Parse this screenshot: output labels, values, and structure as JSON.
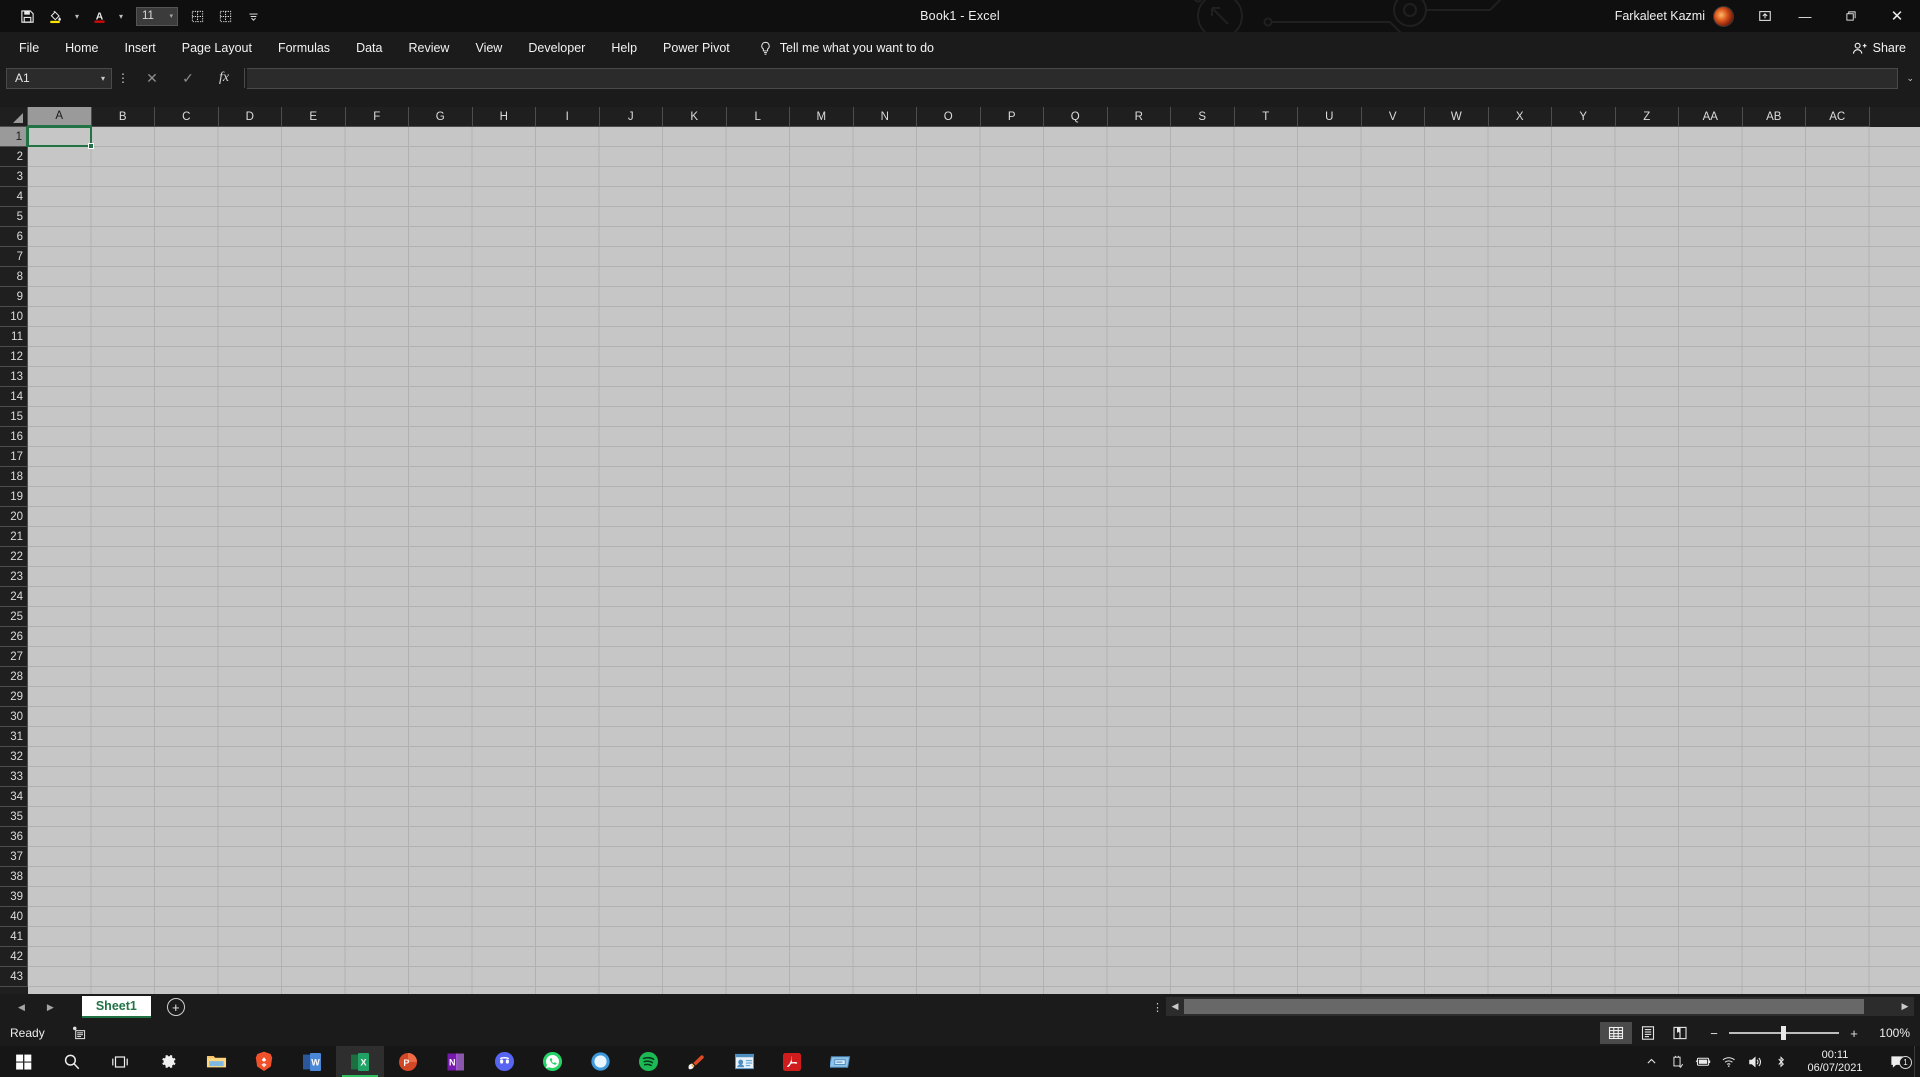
{
  "window": {
    "title": "Book1  -  Excel",
    "user_name": "Farkaleet Kazmi",
    "minimize_label": "—",
    "restore_label": "❐",
    "close_label": "✕",
    "ribbon_display_name": "ribbon-display-options"
  },
  "quick_access": {
    "items": [
      {
        "name": "save-icon",
        "label": "Save"
      },
      {
        "name": "fill-color-icon",
        "label": "Fill Color"
      },
      {
        "name": "fill-color-dropdown",
        "label": "▾"
      },
      {
        "name": "font-color-icon",
        "label": "Font Color"
      },
      {
        "name": "font-color-dropdown",
        "label": "▾"
      },
      {
        "name": "all-borders-icon",
        "label": "All Borders"
      },
      {
        "name": "outside-borders-icon",
        "label": "Outside Borders"
      },
      {
        "name": "customize-qat-icon",
        "label": "Customize Quick Access Toolbar"
      }
    ],
    "font_size": "11",
    "font_size_arrow": "▾"
  },
  "ribbon": {
    "tabs": [
      "File",
      "Home",
      "Insert",
      "Page Layout",
      "Formulas",
      "Data",
      "Review",
      "View",
      "Developer",
      "Help",
      "Power Pivot"
    ],
    "tell_me": "Tell me what you want to do",
    "share": "Share"
  },
  "formula_bar": {
    "name_box": "A1",
    "name_box_arrow": "▾",
    "kebab": "⋮",
    "cancel": "✕",
    "enter": "✓",
    "insert_function": "fx",
    "value": "",
    "expand_arrow": "⌄"
  },
  "grid": {
    "columns": [
      "A",
      "B",
      "C",
      "D",
      "E",
      "F",
      "G",
      "H",
      "I",
      "J",
      "K",
      "L",
      "M",
      "N",
      "O",
      "P",
      "Q",
      "R",
      "S",
      "T",
      "U",
      "V",
      "W",
      "X",
      "Y",
      "Z",
      "AA",
      "AB",
      "AC"
    ],
    "rows": [
      1,
      2,
      3,
      4,
      5,
      6,
      7,
      8,
      9,
      10,
      11,
      12,
      13,
      14,
      15,
      16,
      17,
      18,
      19,
      20,
      21,
      22,
      23,
      24,
      25,
      26,
      27,
      28,
      29,
      30,
      31,
      32,
      33,
      34,
      35,
      36,
      37,
      38,
      39,
      40,
      41,
      42,
      43
    ],
    "selected_cell": "A1",
    "selected_column": "A",
    "selected_row": 1,
    "selection_color": "#217346",
    "cell_background": "#c6c6c6",
    "gridline_color": "#b1b1b1"
  },
  "sheet_tabs": {
    "prev_arrow": "◀",
    "next_arrow": "▶",
    "tabs": [
      {
        "label": "Sheet1",
        "active": true
      }
    ],
    "add_label": "+",
    "kebab": "⋮"
  },
  "status_bar": {
    "status": "Ready",
    "accessibility_icon": "accessibility-checker-icon",
    "views": [
      {
        "name": "normal-view-button",
        "active": true
      },
      {
        "name": "page-layout-view-button",
        "active": false
      },
      {
        "name": "page-break-preview-button",
        "active": false
      }
    ],
    "zoom_out": "−",
    "zoom_in": "+",
    "zoom_level": "100%"
  },
  "taskbar": {
    "items": [
      {
        "name": "start-button",
        "label": "Windows"
      },
      {
        "name": "search-button",
        "label": "Search"
      },
      {
        "name": "task-view-button",
        "label": "Task View"
      },
      {
        "name": "settings-app",
        "label": "Settings"
      },
      {
        "name": "file-explorer-app",
        "label": "File Explorer"
      },
      {
        "name": "brave-browser-app",
        "label": "Brave"
      },
      {
        "name": "word-app",
        "label": "Word",
        "initial": "W"
      },
      {
        "name": "excel-app",
        "label": "Excel",
        "initial": "X",
        "active": true
      },
      {
        "name": "powerpoint-app",
        "label": "PowerPoint",
        "initial": "P"
      },
      {
        "name": "onenote-app",
        "label": "OneNote",
        "initial": "N"
      },
      {
        "name": "discord-app",
        "label": "Discord"
      },
      {
        "name": "whatsapp-app",
        "label": "WhatsApp"
      },
      {
        "name": "blue-app",
        "label": "App"
      },
      {
        "name": "spotify-app",
        "label": "Spotify"
      },
      {
        "name": "ccleaner-app",
        "label": "CCleaner"
      },
      {
        "name": "contacts-app",
        "label": "Contacts"
      },
      {
        "name": "acrobat-reader-app",
        "label": "Adobe Acrobat Reader"
      },
      {
        "name": "snipping-tool-app",
        "label": "Snipping Tool"
      }
    ],
    "tray": [
      {
        "name": "show-hidden-icons",
        "label": "˄"
      },
      {
        "name": "usb-eject-icon",
        "label": "USB"
      },
      {
        "name": "battery-icon",
        "label": "Battery"
      },
      {
        "name": "wifi-icon",
        "label": "Wi-Fi"
      },
      {
        "name": "volume-icon",
        "label": "Volume"
      },
      {
        "name": "bluetooth-icon",
        "label": "Bluetooth"
      }
    ],
    "time": "00:11",
    "date": "06/07/2021",
    "notification_count": "1"
  }
}
